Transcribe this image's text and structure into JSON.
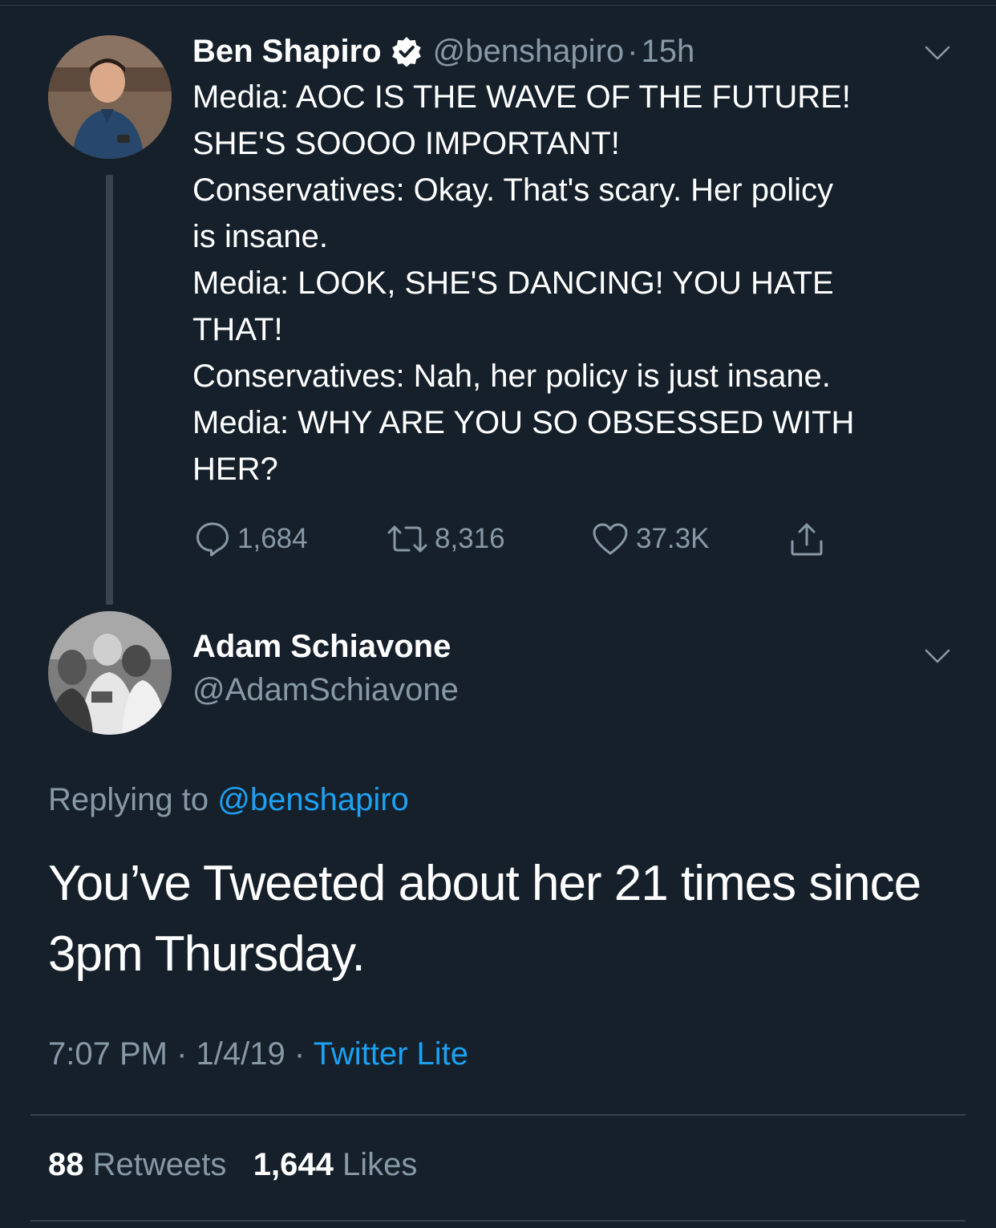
{
  "colors": {
    "background": "#15202b",
    "secondary_text": "#8899a6",
    "link": "#1da1f2",
    "divider": "#38444d"
  },
  "parent_tweet": {
    "author_name": "Ben Shapiro",
    "verified": true,
    "handle": "@benshapiro",
    "separator": "·",
    "time": "15h",
    "body_lines": [
      "Media: AOC IS THE WAVE OF THE FUTURE!",
      "SHE'S SOOOO IMPORTANT!",
      "Conservatives: Okay. That's scary. Her policy",
      "is insane.",
      "Media: LOOK, SHE'S DANCING! YOU HATE",
      "THAT!",
      "Conservatives: Nah, her policy is just insane.",
      "Media: WHY ARE YOU SO OBSESSED WITH",
      "HER?"
    ],
    "actions": {
      "replies": "1,684",
      "retweets": "8,316",
      "likes": "37.3K"
    },
    "icons": {
      "avatar": "avatar-photo",
      "verified": "verified-badge-icon",
      "menu": "chevron-down-icon",
      "reply": "reply-bubble-icon",
      "retweet": "retweet-icon",
      "like": "heart-icon",
      "share": "share-icon"
    }
  },
  "reply_tweet": {
    "author_name": "Adam Schiavone",
    "handle": "@AdamSchiavone",
    "replying_prefix": "Replying to",
    "replying_to": "@benshapiro",
    "body_lines": [
      "You’ve Tweeted about her 21 times since",
      "3pm Thursday."
    ],
    "time": "7:07 PM",
    "date": "1/4/19",
    "separator": "·",
    "source": "Twitter Lite",
    "retweet_count": "88",
    "retweet_label": "Retweets",
    "like_count": "1,644",
    "like_label": "Likes"
  }
}
